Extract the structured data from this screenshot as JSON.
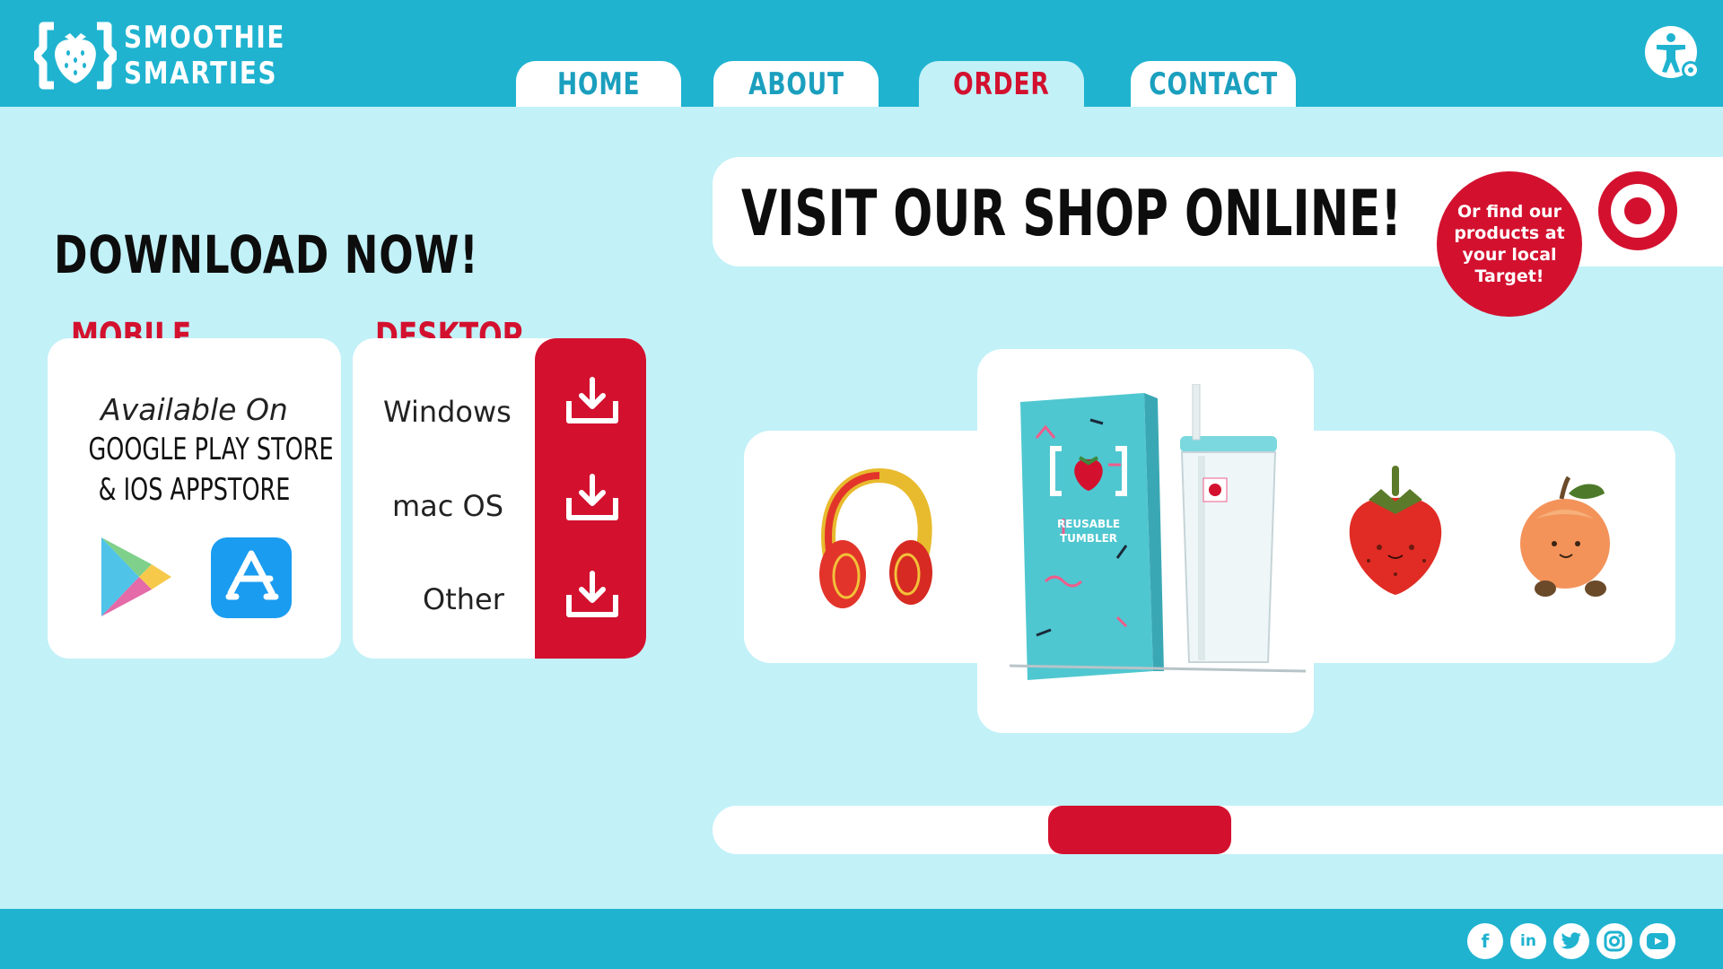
{
  "brand": {
    "line1": "SMOOTHIE",
    "line2": "SMARTIES",
    "logo_icon": "strawberry-brackets-icon"
  },
  "nav": {
    "tabs": [
      {
        "label": "HOME",
        "active": false
      },
      {
        "label": "ABOUT",
        "active": false
      },
      {
        "label": "ORDER",
        "active": true
      },
      {
        "label": "CONTACT",
        "active": false
      }
    ]
  },
  "accessibility_icon": "accessibility-settings-icon",
  "download": {
    "title": "DOWNLOAD NOW!",
    "mobile": {
      "label": "MOBILE",
      "available_on": "Available On",
      "stores_line1": "GOOGLE PLAY STORE",
      "stores_line2": "& IOS APPSTORE",
      "icons": [
        "google-play-icon",
        "app-store-icon"
      ]
    },
    "desktop": {
      "label": "DESKTOP",
      "options": [
        "Windows",
        "mac OS",
        "Other"
      ],
      "icon": "download-icon"
    }
  },
  "shop": {
    "title": "VISIT OUR SHOP ONLINE!",
    "target_note": "Or find our products at your local Target!",
    "target_icon": "target-logo-icon",
    "products": [
      "headphones",
      "reusable-tumbler",
      "strawberry-plush",
      "peach-plush"
    ],
    "tumbler_box_text_line1": "REUSABLE",
    "tumbler_box_text_line2": "TUMBLER",
    "scroll_position": 0.33
  },
  "footer": {
    "social": [
      "facebook-icon",
      "linkedin-icon",
      "twitter-icon",
      "instagram-icon",
      "youtube-icon"
    ]
  },
  "colors": {
    "header": "#1fb3d0",
    "background": "#c2f1f8",
    "accent_red": "#d3112f",
    "nav_text": "#1b9fbe"
  }
}
